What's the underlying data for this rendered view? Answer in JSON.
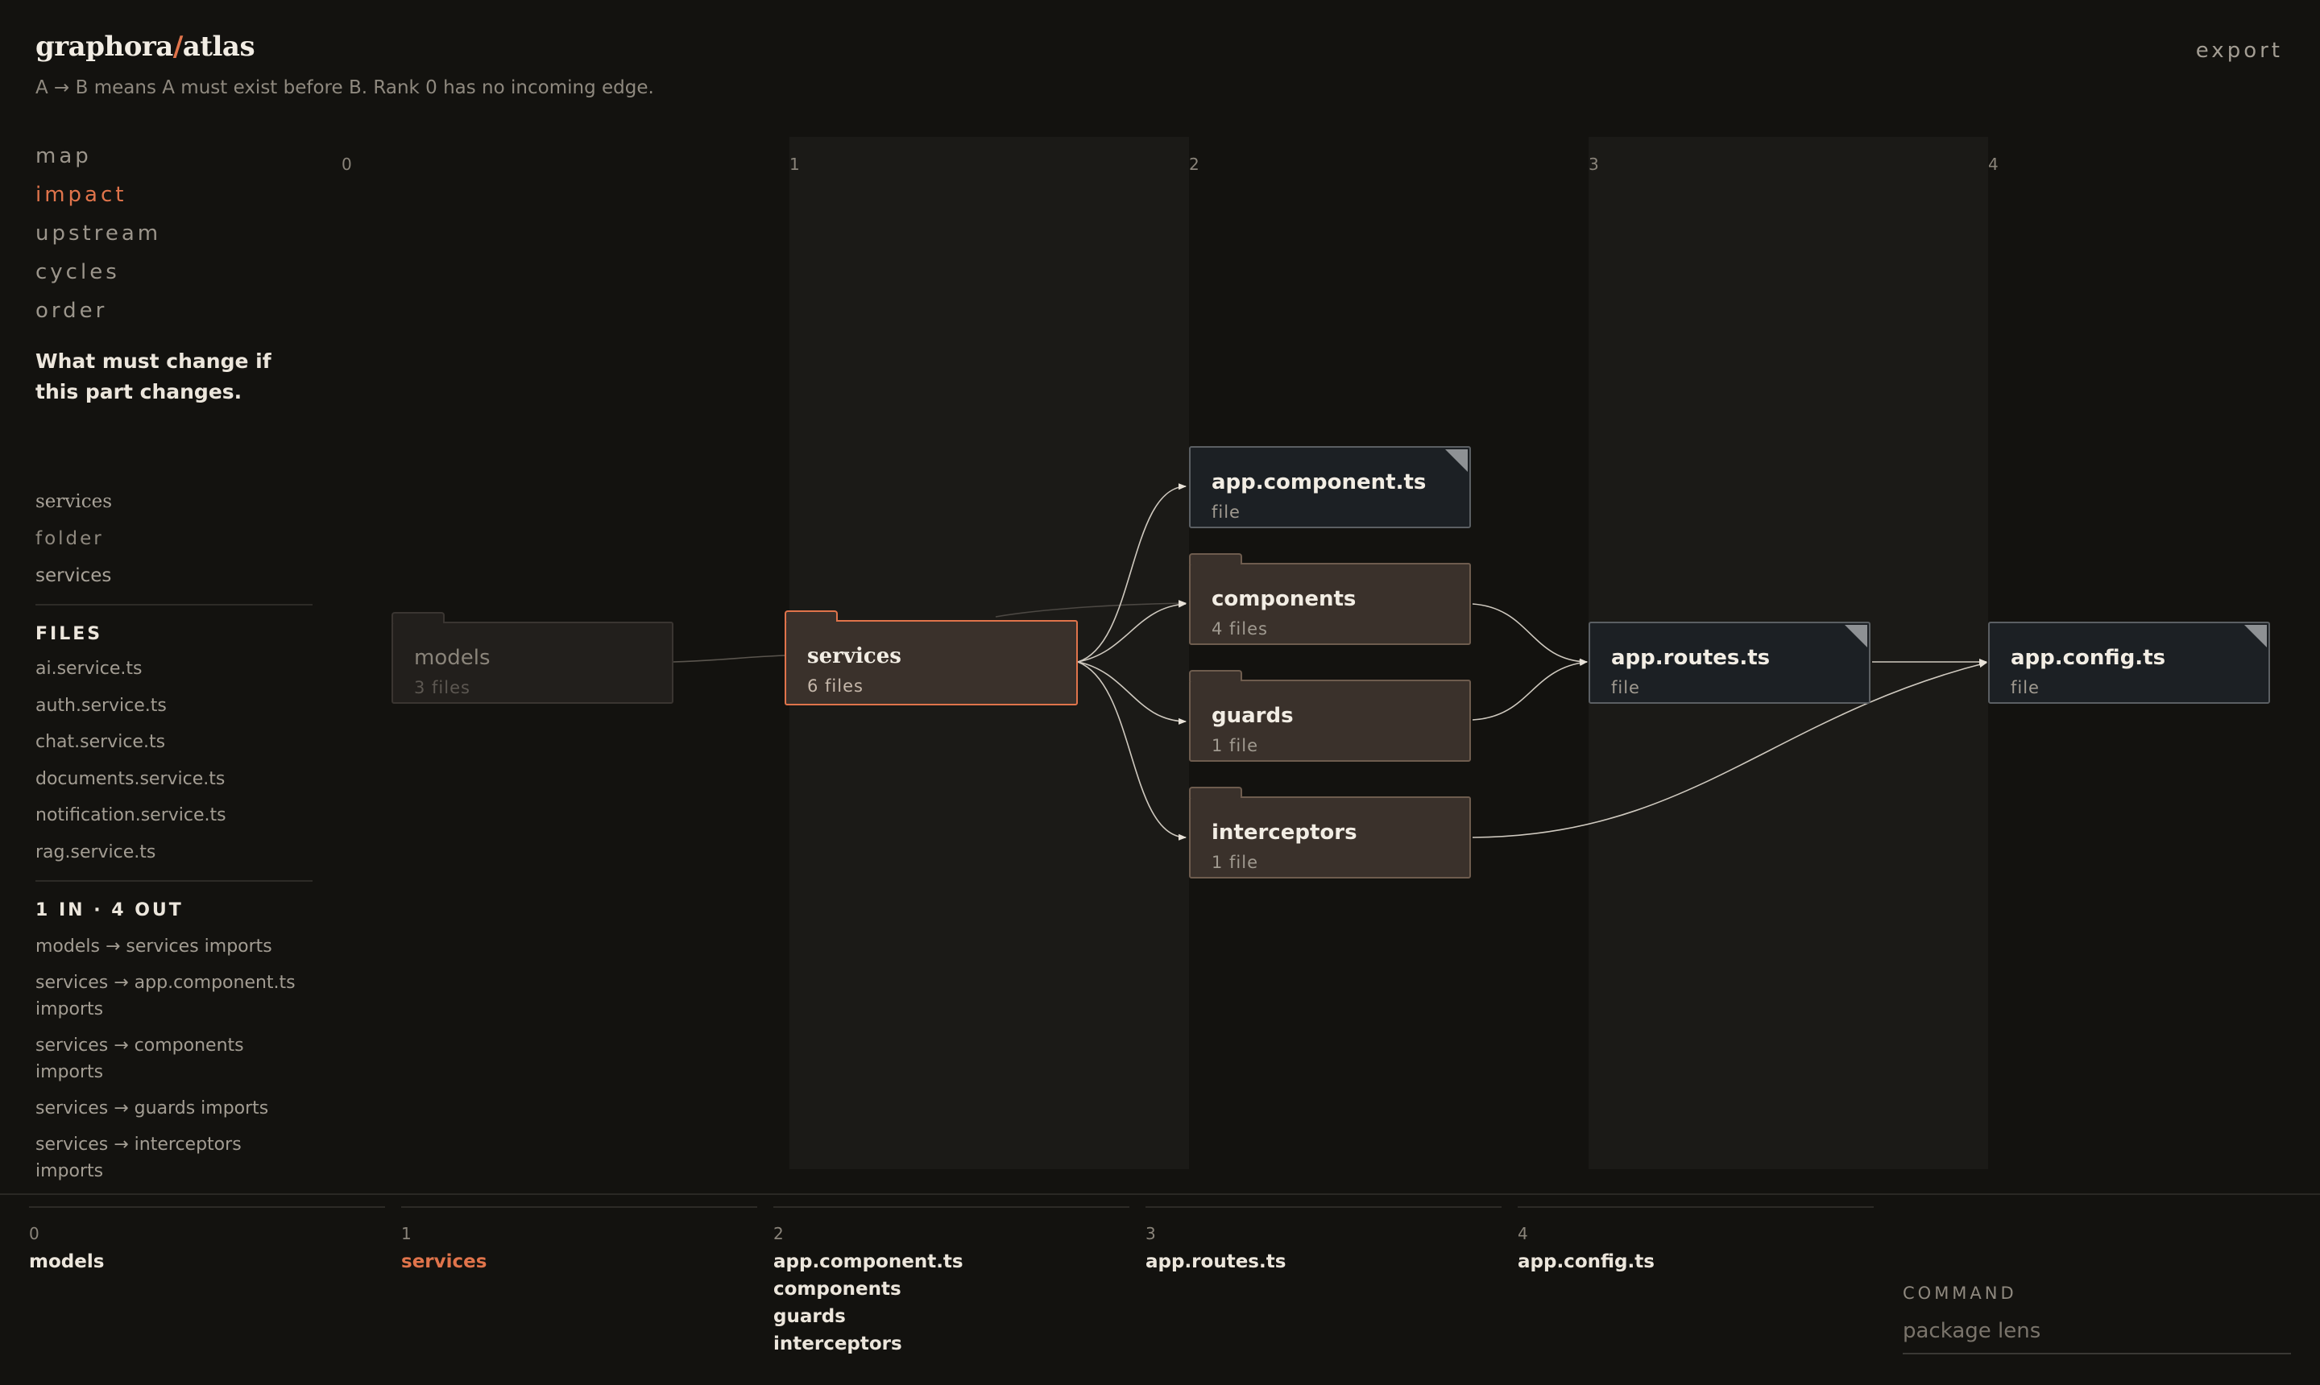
{
  "brand": {
    "left": "graphora",
    "slash": "/",
    "right": "atlas"
  },
  "subtitle": "A → B means A must exist before B. Rank 0 has no incoming edge.",
  "export_label": "export",
  "nav": {
    "items": [
      "map",
      "impact",
      "upstream",
      "cycles",
      "order"
    ],
    "active": "impact",
    "description": "What must change if this part changes."
  },
  "selection": {
    "name": "services",
    "kind": "folder",
    "path": "services"
  },
  "files": {
    "heading": "FILES",
    "items": [
      "ai.service.ts",
      "auth.service.ts",
      "chat.service.ts",
      "documents.service.ts",
      "notification.service.ts",
      "rag.service.ts"
    ]
  },
  "edges_panel": {
    "heading": "1 IN · 4 OUT",
    "items": [
      "models → services imports",
      "services → app.component.ts imports",
      "services → components imports",
      "services → guards imports",
      "services → interceptors imports"
    ]
  },
  "graph": {
    "ranks": [
      "0",
      "1",
      "2",
      "3",
      "4"
    ],
    "nodes": {
      "models": {
        "title": "models",
        "sub": "3 files"
      },
      "services": {
        "title": "services",
        "sub": "6 files"
      },
      "app_component": {
        "title": "app.component.ts",
        "sub": "file"
      },
      "components": {
        "title": "components",
        "sub": "4 files"
      },
      "guards": {
        "title": "guards",
        "sub": "1 file"
      },
      "interceptors": {
        "title": "interceptors",
        "sub": "1 file"
      },
      "app_routes": {
        "title": "app.routes.ts",
        "sub": "file"
      },
      "app_config": {
        "title": "app.config.ts",
        "sub": "file"
      }
    },
    "colors": {
      "accent": "#e0744b",
      "folder": "#3a312b",
      "file": "#1c2024",
      "edge": "#cfc9bf"
    }
  },
  "order_columns": [
    {
      "rank": "0",
      "items": [
        "models"
      ]
    },
    {
      "rank": "1",
      "items": [
        "services"
      ]
    },
    {
      "rank": "2",
      "items": [
        "app.component.ts",
        "components",
        "guards",
        "interceptors"
      ]
    },
    {
      "rank": "3",
      "items": [
        "app.routes.ts"
      ]
    },
    {
      "rank": "4",
      "items": [
        "app.config.ts"
      ]
    }
  ],
  "command": {
    "label": "COMMAND",
    "placeholder": "package lens"
  }
}
